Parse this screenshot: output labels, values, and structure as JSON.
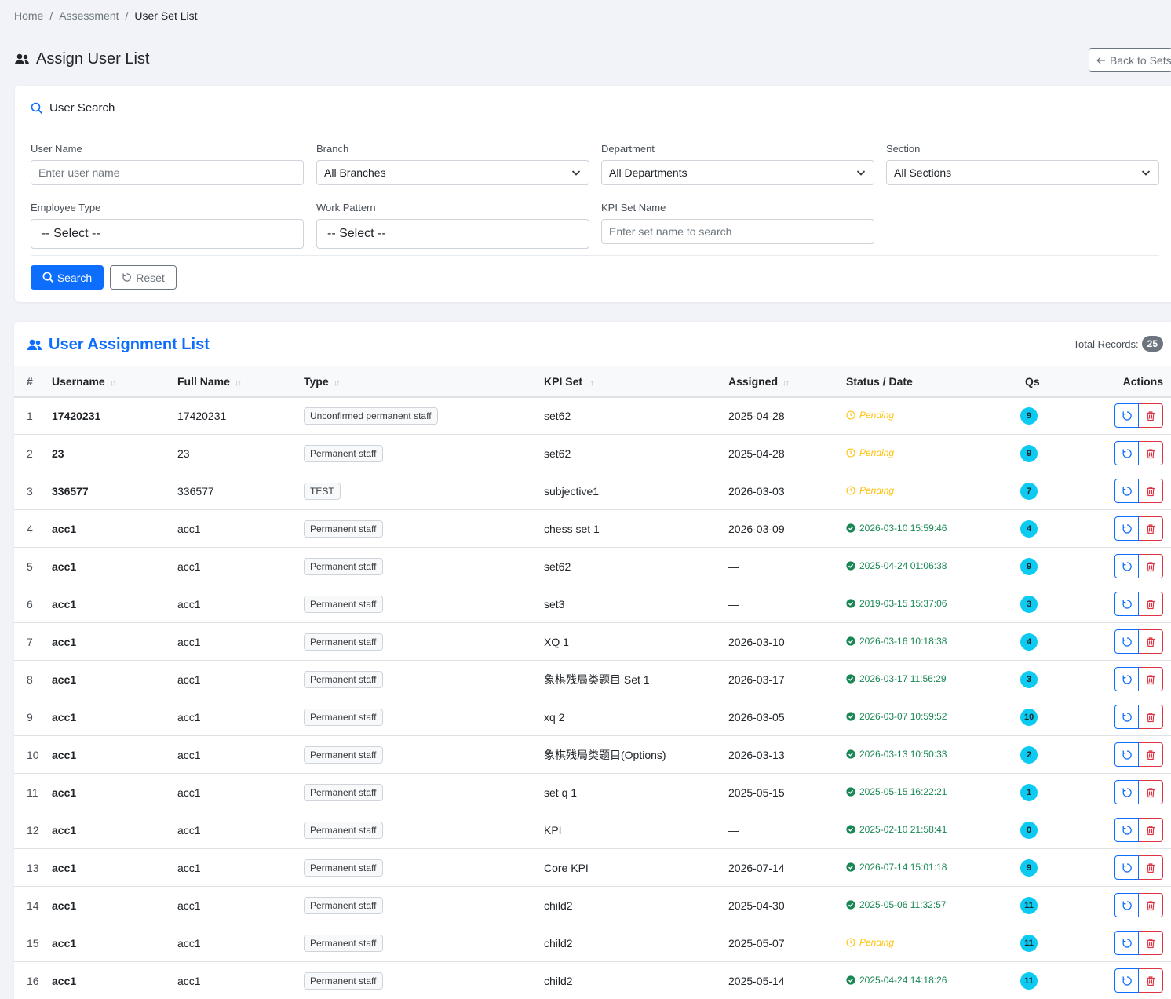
{
  "breadcrumb": {
    "home": "Home",
    "assessment": "Assessment",
    "current": "User Set List"
  },
  "header": {
    "title": "Assign User List",
    "back_label": "Back to Sets"
  },
  "search": {
    "title": "User Search",
    "user_name": {
      "label": "User Name",
      "placeholder": "Enter user name"
    },
    "branch": {
      "label": "Branch",
      "value": "All Branches"
    },
    "department": {
      "label": "Department",
      "value": "All Departments"
    },
    "section": {
      "label": "Section",
      "value": "All Sections"
    },
    "employee_type": {
      "label": "Employee Type",
      "value": "-- Select --"
    },
    "work_pattern": {
      "label": "Work Pattern",
      "value": "-- Select --"
    },
    "kpi_set_name": {
      "label": "KPI Set Name",
      "placeholder": "Enter set name to search"
    },
    "search_label": "Search",
    "reset_label": "Reset"
  },
  "list": {
    "title": "User Assignment List",
    "total_label": "Total Records:",
    "total": "25",
    "columns": {
      "num": "#",
      "username": "Username",
      "full_name": "Full Name",
      "type": "Type",
      "kpi_set": "KPI Set",
      "assigned": "Assigned",
      "status": "Status / Date",
      "qs": "Qs",
      "actions": "Actions"
    },
    "sort_glyph": "↓↑",
    "rows": [
      {
        "num": "1",
        "username": "17420231",
        "full_name": "17420231",
        "type": "Unconfirmed permanent staff",
        "kpi_set": "set62",
        "assigned": "2025-04-28",
        "status": "Pending",
        "status_kind": "pending",
        "qs": "9"
      },
      {
        "num": "2",
        "username": "23",
        "full_name": "23",
        "type": "Permanent staff",
        "kpi_set": "set62",
        "assigned": "2025-04-28",
        "status": "Pending",
        "status_kind": "pending",
        "qs": "9"
      },
      {
        "num": "3",
        "username": "336577",
        "full_name": "336577",
        "type": "TEST",
        "kpi_set": "subjective1",
        "assigned": "2026-03-03",
        "status": "Pending",
        "status_kind": "pending",
        "qs": "7"
      },
      {
        "num": "4",
        "username": "acc1",
        "full_name": "acc1",
        "type": "Permanent staff",
        "kpi_set": "chess set 1",
        "assigned": "2026-03-09",
        "status": "2026-03-10 15:59:46",
        "status_kind": "done",
        "qs": "4"
      },
      {
        "num": "5",
        "username": "acc1",
        "full_name": "acc1",
        "type": "Permanent staff",
        "kpi_set": "set62",
        "assigned": "—",
        "status": "2025-04-24 01:06:38",
        "status_kind": "done",
        "qs": "9"
      },
      {
        "num": "6",
        "username": "acc1",
        "full_name": "acc1",
        "type": "Permanent staff",
        "kpi_set": "set3",
        "assigned": "—",
        "status": "2019-03-15 15:37:06",
        "status_kind": "done",
        "qs": "3"
      },
      {
        "num": "7",
        "username": "acc1",
        "full_name": "acc1",
        "type": "Permanent staff",
        "kpi_set": "XQ 1",
        "assigned": "2026-03-10",
        "status": "2026-03-16 10:18:38",
        "status_kind": "done",
        "qs": "4"
      },
      {
        "num": "8",
        "username": "acc1",
        "full_name": "acc1",
        "type": "Permanent staff",
        "kpi_set": "象棋残局类题目 Set 1",
        "assigned": "2026-03-17",
        "status": "2026-03-17 11:56:29",
        "status_kind": "done",
        "qs": "3"
      },
      {
        "num": "9",
        "username": "acc1",
        "full_name": "acc1",
        "type": "Permanent staff",
        "kpi_set": "xq 2",
        "assigned": "2026-03-05",
        "status": "2026-03-07 10:59:52",
        "status_kind": "done",
        "qs": "10"
      },
      {
        "num": "10",
        "username": "acc1",
        "full_name": "acc1",
        "type": "Permanent staff",
        "kpi_set": "象棋残局类题目(Options)",
        "assigned": "2026-03-13",
        "status": "2026-03-13 10:50:33",
        "status_kind": "done",
        "qs": "2"
      },
      {
        "num": "11",
        "username": "acc1",
        "full_name": "acc1",
        "type": "Permanent staff",
        "kpi_set": "set q 1",
        "assigned": "2025-05-15",
        "status": "2025-05-15 16:22:21",
        "status_kind": "done",
        "qs": "1"
      },
      {
        "num": "12",
        "username": "acc1",
        "full_name": "acc1",
        "type": "Permanent staff",
        "kpi_set": "KPI",
        "assigned": "—",
        "status": "2025-02-10 21:58:41",
        "status_kind": "done",
        "qs": "0"
      },
      {
        "num": "13",
        "username": "acc1",
        "full_name": "acc1",
        "type": "Permanent staff",
        "kpi_set": "Core KPI",
        "assigned": "2026-07-14",
        "status": "2026-07-14 15:01:18",
        "status_kind": "done",
        "qs": "9"
      },
      {
        "num": "14",
        "username": "acc1",
        "full_name": "acc1",
        "type": "Permanent staff",
        "kpi_set": "child2",
        "assigned": "2025-04-30",
        "status": "2025-05-06 11:32:57",
        "status_kind": "done",
        "qs": "11"
      },
      {
        "num": "15",
        "username": "acc1",
        "full_name": "acc1",
        "type": "Permanent staff",
        "kpi_set": "child2",
        "assigned": "2025-05-07",
        "status": "Pending",
        "status_kind": "pending",
        "qs": "11"
      },
      {
        "num": "16",
        "username": "acc1",
        "full_name": "acc1",
        "type": "Permanent staff",
        "kpi_set": "child2",
        "assigned": "2025-05-14",
        "status": "2025-04-24 14:18:26",
        "status_kind": "done",
        "qs": "11"
      }
    ]
  },
  "icons": {
    "users": "users-icon",
    "search": "search-icon",
    "reset": "rotate-icon",
    "back": "arrow-left-icon",
    "pending": "clock-icon",
    "done": "check-circle-icon",
    "reassign": "rotate-icon",
    "delete": "trash-icon"
  },
  "colors": {
    "primary": "#0d6efd",
    "danger": "#dc3545",
    "success": "#198754",
    "warning": "#ffc107",
    "info": "#0dcaf0"
  }
}
